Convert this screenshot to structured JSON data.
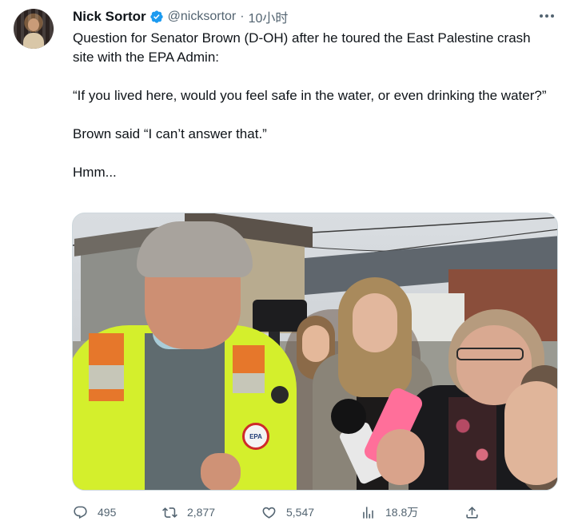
{
  "tweet": {
    "author": {
      "name": "Nick Sortor",
      "handle": "@nicksortor",
      "verified": true
    },
    "separator": "·",
    "time": "10小时",
    "text": [
      "Question for Senator Brown (D-OH) after he toured the East Palestine crash site with the EPA Admin:",
      "“If you lived here, would you feel safe in the water, or even drinking the water?”",
      "Brown said “I can’t answer that.”",
      "Hmm..."
    ],
    "media": {
      "patch_text": "EPA"
    },
    "actions": {
      "replies": "495",
      "retweets": "2,877",
      "likes": "5,547",
      "views": "18.8万"
    }
  },
  "icons": {
    "verified": "verified-badge-icon",
    "more": "more-options-icon",
    "reply": "reply-icon",
    "retweet": "retweet-icon",
    "like": "heart-icon",
    "views": "views-chart-icon",
    "share": "share-icon"
  },
  "colors": {
    "text": "#0f1419",
    "secondary": "#536471",
    "verified": "#1d9bf0",
    "border": "#cfd9de"
  }
}
